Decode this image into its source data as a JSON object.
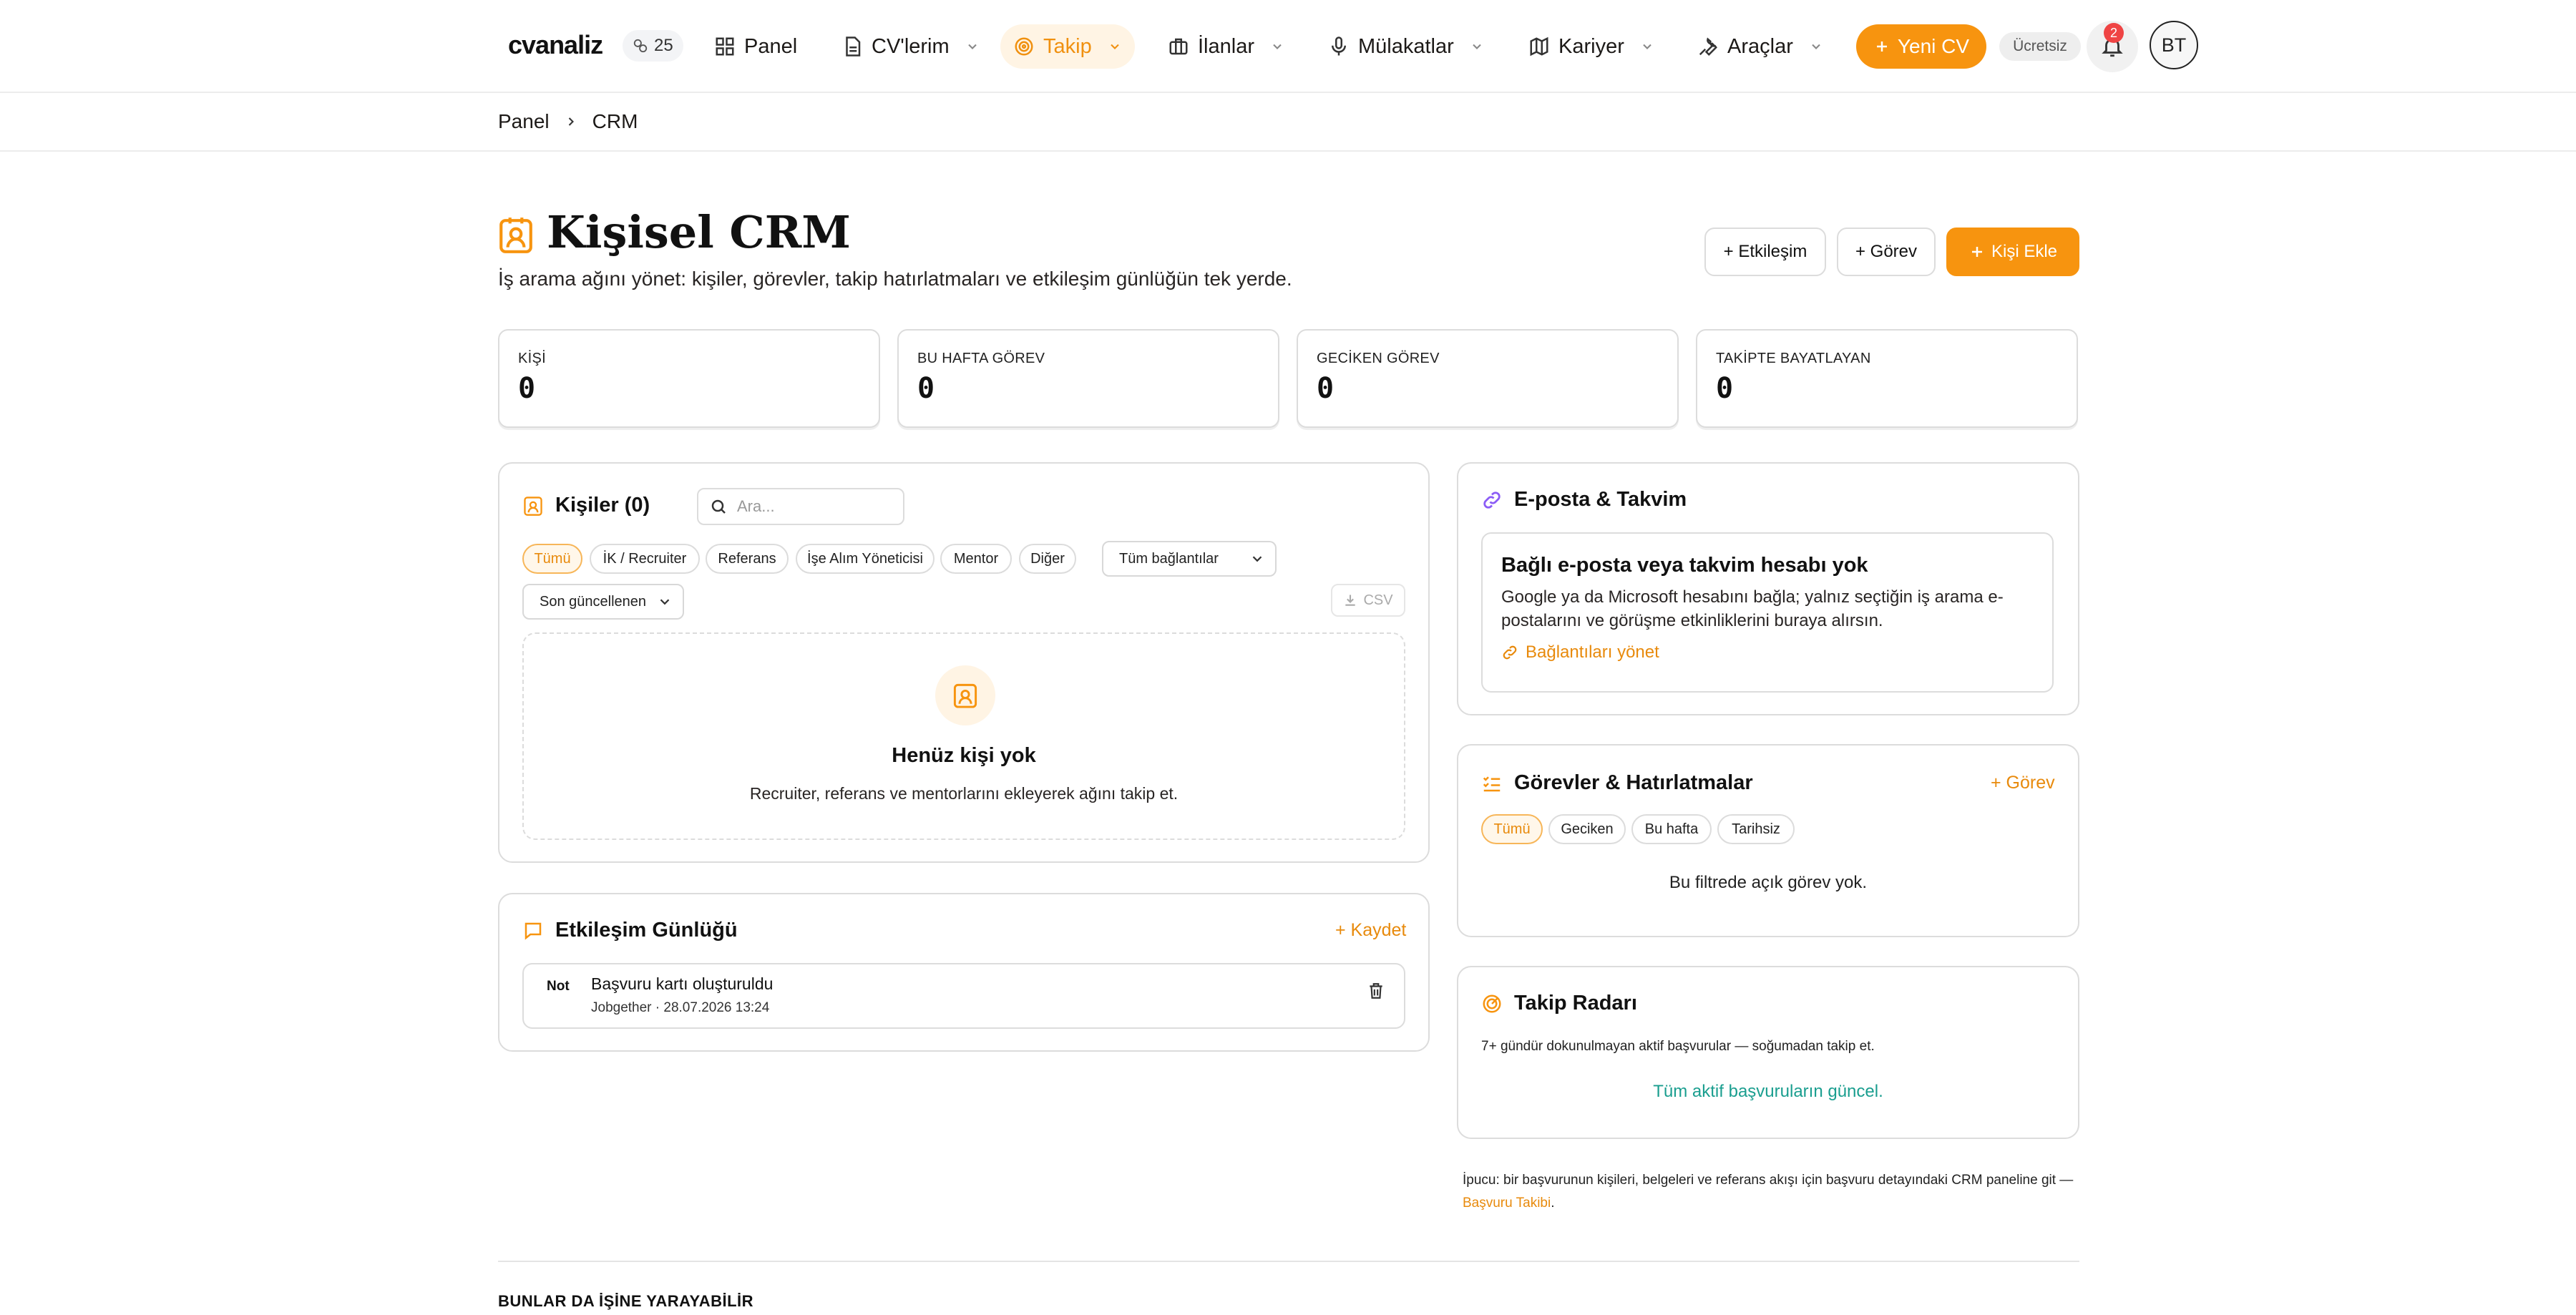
{
  "brand": {
    "logo": "cvanaliz",
    "credits": "25"
  },
  "nav": [
    {
      "label": "Panel",
      "icon": "grid-icon"
    },
    {
      "label": "CV'lerim",
      "icon": "file-icon"
    },
    {
      "label": "Takip",
      "icon": "target-icon",
      "active": true
    },
    {
      "label": "İlanlar",
      "icon": "briefcase-icon"
    },
    {
      "label": "Mülakatlar",
      "icon": "microphone-icon"
    },
    {
      "label": "Kariyer",
      "icon": "map-icon"
    },
    {
      "label": "Araçlar",
      "icon": "wrench-icon"
    }
  ],
  "topbar": {
    "new_cv": "Yeni CV",
    "plan": "Ücretsiz",
    "notifications": "2",
    "avatar": "BT"
  },
  "breadcrumb": {
    "root": "Panel",
    "current": "CRM"
  },
  "header": {
    "title": "Kişisel CRM",
    "subtitle": "İş arama ağını yönet: kişiler, görevler, takip hatırlatmaları ve etkileşim günlüğün tek yerde.",
    "btn_interaction": "+ Etkileşim",
    "btn_task": "+ Görev",
    "btn_add_person": "Kişi Ekle"
  },
  "stats": [
    {
      "label": "KİŞİ",
      "value": "0"
    },
    {
      "label": "BU HAFTA GÖREV",
      "value": "0"
    },
    {
      "label": "GECİKEN GÖREV",
      "value": "0"
    },
    {
      "label": "TAKİPTE BAYATLAYAN",
      "value": "0"
    }
  ],
  "contacts": {
    "title": "Kişiler (0)",
    "search_placeholder": "Ara...",
    "filters": [
      "Tümü",
      "İK / Recruiter",
      "Referans",
      "İşe Alım Yöneticisi",
      "Mentor",
      "Diğer"
    ],
    "connection_select": "Tüm bağlantılar",
    "sort_select": "Son güncellenen",
    "csv": "CSV",
    "empty_title": "Henüz kişi yok",
    "empty_text": "Recruiter, referans ve mentorlarını ekleyerek ağını takip et."
  },
  "log": {
    "title": "Etkileşim Günlüğü",
    "save": "+ Kaydet",
    "entries": [
      {
        "tag": "Not",
        "title": "Başvuru kartı oluşturuldu",
        "meta": "Jobgether · 28.07.2026 13:24"
      }
    ]
  },
  "email": {
    "title": "E-posta & Takvim",
    "box_title": "Bağlı e-posta veya takvim hesabı yok",
    "box_text": "Google ya da Microsoft hesabını bağla; yalnız seçtiğin iş arama e-postalarını ve görüşme etkinliklerini buraya alırsın.",
    "box_link": "Bağlantıları yönet"
  },
  "tasks": {
    "title": "Görevler & Hatırlatmalar",
    "add": "+ Görev",
    "filters": [
      "Tümü",
      "Geciken",
      "Bu hafta",
      "Tarihsiz"
    ],
    "empty": "Bu filtrede açık görev yok."
  },
  "radar": {
    "title": "Takip Radarı",
    "desc": "7+ gündür dokunulmayan aktif başvurular — soğumadan takip et.",
    "status": "Tüm aktif başvuruların güncel."
  },
  "tip": {
    "text": "İpucu: bir başvurunun kişileri, belgeleri ve referans akışı için başvuru detayındaki CRM paneline git — ",
    "link": "Başvuru Takibi",
    "end": "."
  },
  "also": "BUNLAR DA İŞİNE YARAYABİLİR",
  "colors": {
    "accent": "#f7940f",
    "accent_soft": "#fff4e4",
    "success": "#1a9e8f",
    "danger": "#ef4444",
    "link_purple": "#8b5cf6"
  }
}
